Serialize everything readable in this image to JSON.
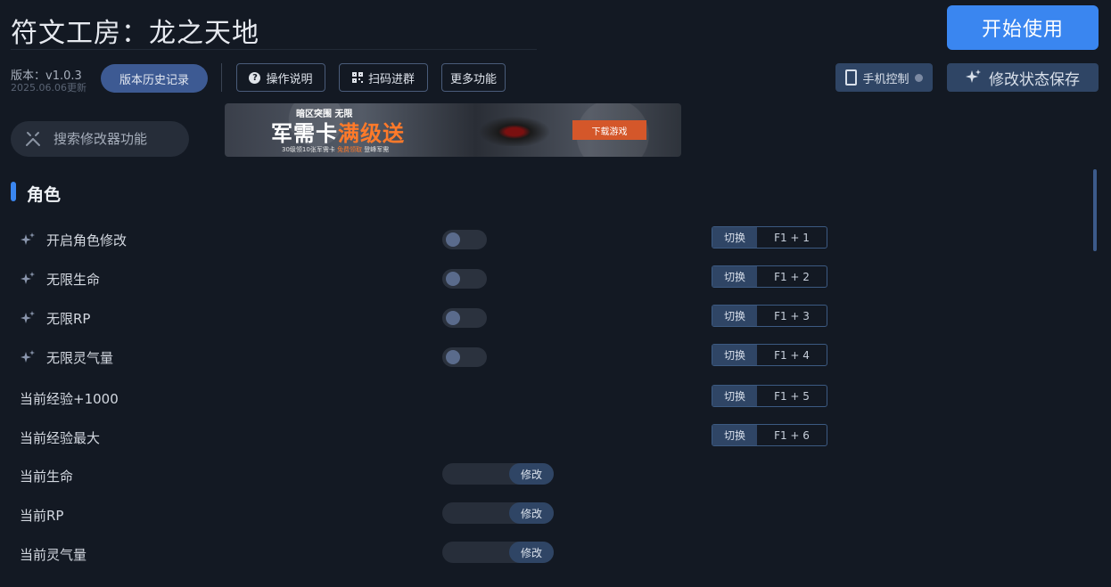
{
  "header": {
    "title": "符文工房：龙之天地",
    "start_label": "开始使用",
    "version": "版本：v1.0.3",
    "updated": "2025.06.06更新",
    "history_label": "版本历史记录",
    "help_label": "操作说明",
    "qr_label": "扫码进群",
    "more_label": "更多功能",
    "phone_label": "手机控制",
    "save_label": "修改状态保存"
  },
  "search": {
    "placeholder": "搜索修改器功能"
  },
  "banner": {
    "top_text": "暗区突围 无限",
    "main_text": "军需卡",
    "main_highlight": "满级送",
    "sub_text": "30级领10张军需卡",
    "sub_highlight": "免费领取",
    "sub_tail": "登峰军需",
    "button_label": "下载游戏"
  },
  "section": {
    "title": "角色"
  },
  "toggle_rows": [
    {
      "label": "开启角色修改",
      "switch": "切换",
      "hotkey": "F1 + 1",
      "on": false
    },
    {
      "label": "无限生命",
      "switch": "切换",
      "hotkey": "F1 + 2",
      "on": false
    },
    {
      "label": "无限RP",
      "switch": "切换",
      "hotkey": "F1 + 3",
      "on": false
    },
    {
      "label": "无限灵气量",
      "switch": "切换",
      "hotkey": "F1 + 4",
      "on": false
    }
  ],
  "action_rows": [
    {
      "label": "当前经验+1000",
      "switch": "切换",
      "hotkey": "F1 + 5"
    },
    {
      "label": "当前经验最大",
      "switch": "切换",
      "hotkey": "F1 + 6"
    }
  ],
  "value_rows": [
    {
      "label": "当前生命",
      "button": "修改"
    },
    {
      "label": "当前RP",
      "button": "修改"
    },
    {
      "label": "当前灵气量",
      "button": "修改"
    }
  ],
  "colors": {
    "background": "#131923",
    "accent": "#3a86f0",
    "button_dark": "#2f4565"
  }
}
